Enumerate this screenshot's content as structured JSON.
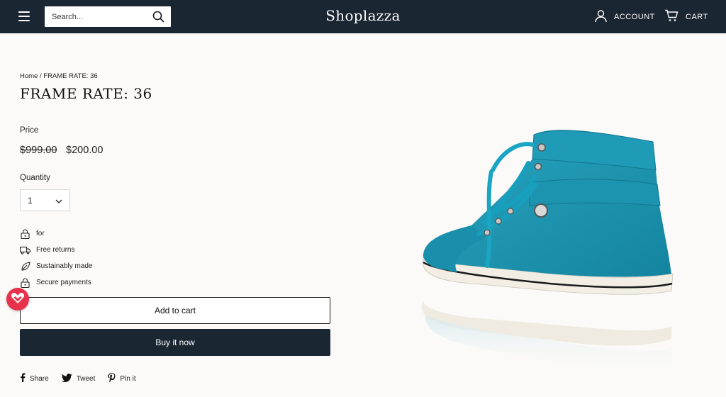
{
  "header": {
    "search_placeholder": "Search...",
    "logo": "Shoplazza",
    "account_label": "ACCOUNT",
    "cart_label": "CART",
    "bg_color": "#1b2633"
  },
  "product": {
    "breadcrumb_home": "Home",
    "breadcrumb_sep": " / ",
    "breadcrumb_current": "FRAME RATE: 36",
    "title": "FRAME RATE: 36",
    "price_label": "Price",
    "price_old": "$999.00",
    "price_new": "$200.00",
    "quantity_label": "Quantity",
    "quantity_value": "1",
    "features": [
      {
        "icon": "lock-icon",
        "text": "for"
      },
      {
        "icon": "truck-icon",
        "text": "Free returns"
      },
      {
        "icon": "leaf-icon",
        "text": "Sustainably made"
      },
      {
        "icon": "lock-icon",
        "text": "Secure payments"
      }
    ],
    "add_to_cart": "Add to cart",
    "buy_now": "Buy it now",
    "image_icon": "sneaker-image"
  },
  "share": {
    "facebook": "Share",
    "twitter": "Tweet",
    "pinterest": "Pin it"
  },
  "badge": {
    "icon": "gift-heart-icon",
    "color": "#e8314a"
  }
}
